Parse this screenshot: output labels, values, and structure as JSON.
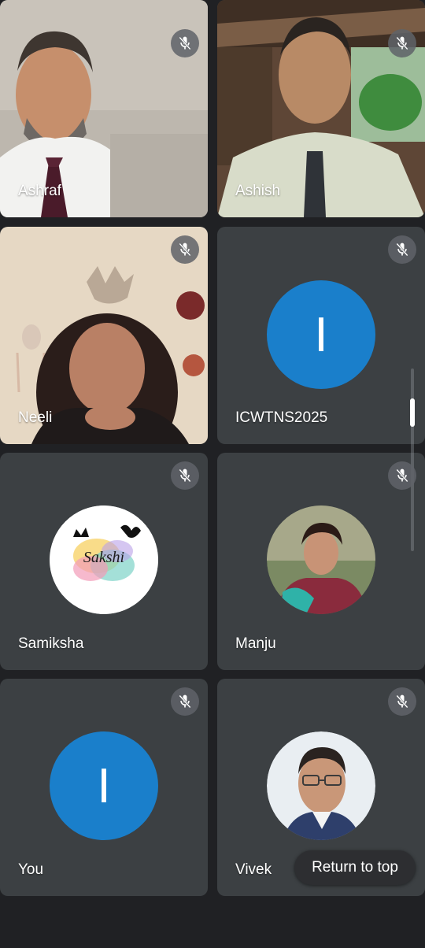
{
  "participants": [
    {
      "name": "Ashraf",
      "muted": true,
      "type": "video"
    },
    {
      "name": "Ashish",
      "muted": true,
      "type": "video"
    },
    {
      "name": "Neeli",
      "muted": true,
      "type": "video"
    },
    {
      "name": "ICWTNS2025",
      "muted": true,
      "type": "initial",
      "initial": "I"
    },
    {
      "name": "Samiksha",
      "muted": true,
      "type": "photo",
      "avatar_text": "Sakshi"
    },
    {
      "name": "Manju",
      "muted": true,
      "type": "photo"
    },
    {
      "name": "You",
      "muted": true,
      "type": "initial",
      "initial": "I"
    },
    {
      "name": "Vivek",
      "muted": true,
      "type": "photo"
    }
  ],
  "return_to_top_label": "Return to top",
  "colors": {
    "background": "#202124",
    "tile": "#3c4043",
    "avatar_blue": "#1a7fcb"
  },
  "icons": {
    "mute": "mic-off-icon"
  }
}
